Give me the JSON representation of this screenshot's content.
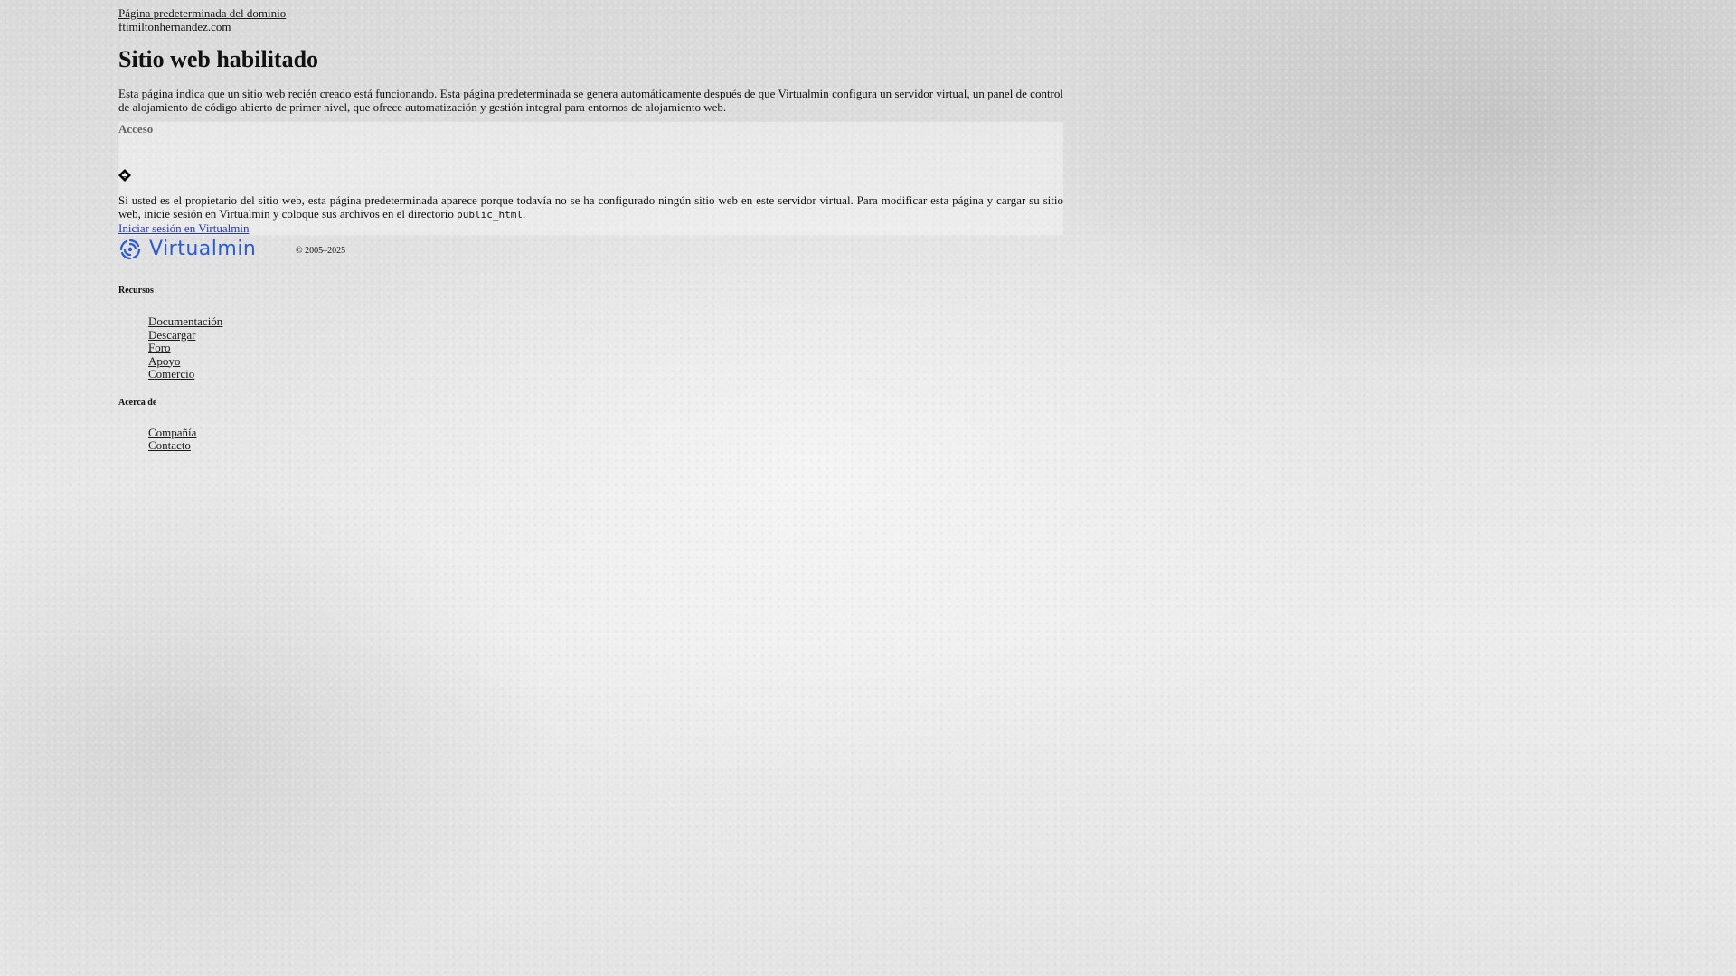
{
  "header": {
    "top_link": "Página predeterminada del dominio",
    "domain": "ftimiltonhernandez.com"
  },
  "main": {
    "title": "Sitio web habilitado",
    "intro": "Esta página indica que un sitio web recién creado está funcionando. Esta página predeterminada se genera automáticamente después de que Virtualmin configura un servidor virtual, un panel de control de alojamiento de código abierto de primer nivel, que ofrece automatización y gestión integral para entornos de alojamiento web."
  },
  "access": {
    "title": "Acceso",
    "icon": "diamond-icon",
    "text_before": "Si usted es el propietario del sitio web, esta página predeterminada aparece porque todavía no se ha configurado ningún sitio web en este servidor virtual. Para modificar esta página y cargar su sitio web, inicie sesión en Virtualmin y coloque sus archivos en el directorio ",
    "code": "public_html",
    "text_after": ".",
    "login_link": "Iniciar sesión en Virtualmin"
  },
  "brand": {
    "logo_text": "Virtualmin",
    "logo_color": "#2a5bd7",
    "copyright": "© 2005–2025"
  },
  "resources": {
    "title": "Recursos",
    "items": [
      "Documentación",
      "Descargar",
      "Foro",
      "Apoyo",
      "Comercio"
    ]
  },
  "about": {
    "title": "Acerca de",
    "items": [
      "Compañía",
      "Contacto"
    ]
  },
  "colors": {
    "link": "#1a1a1a",
    "login_link": "#2233cc"
  }
}
